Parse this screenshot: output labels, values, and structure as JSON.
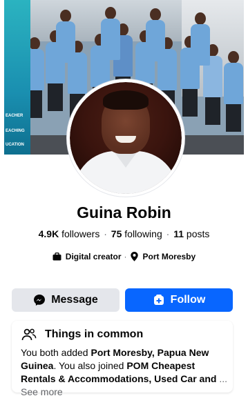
{
  "profile": {
    "name": "Guina Robin",
    "followers_count": "4.9K",
    "followers_label": "followers",
    "following_count": "75",
    "following_label": "following",
    "posts_count": "11",
    "posts_label": "posts",
    "category": "Digital creator",
    "location": "Port Moresby"
  },
  "cover_banner_words": [
    "EACHER",
    "EACHING",
    "UCATION"
  ],
  "actions": {
    "message_label": "Message",
    "follow_label": "Follow"
  },
  "common": {
    "title": "Things in common",
    "text_1": "You both added ",
    "place": "Port Moresby, Papua New Guinea",
    "text_2": ". You also joined ",
    "groups": "POM Cheapest Rentals & Accommodations, Used Car and",
    "ellipsis": " ... ",
    "see_more": "See more"
  },
  "colors": {
    "follow_bg": "#0866ff",
    "message_bg": "#e4e6eb",
    "secondary_text": "#65676b"
  },
  "icons": {
    "category": "briefcase-icon",
    "location": "location-pin-icon",
    "message": "messenger-icon",
    "follow": "add-friend-icon",
    "common": "people-icon"
  }
}
